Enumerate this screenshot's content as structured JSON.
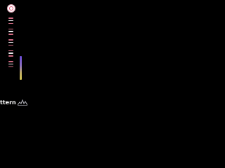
{
  "toolbar": {
    "menu_count": 5
  },
  "pattern": {
    "label": "ttern",
    "icon": "mountain-pattern-icon"
  },
  "colors": {
    "background": "#000000",
    "avatar_accent": "#e0557a",
    "menu_bar_pink": "#d06a82",
    "menu_bar_white": "#e7e7ea",
    "slider_top": "#6a4ad6",
    "slider_bottom": "#d4c650"
  }
}
